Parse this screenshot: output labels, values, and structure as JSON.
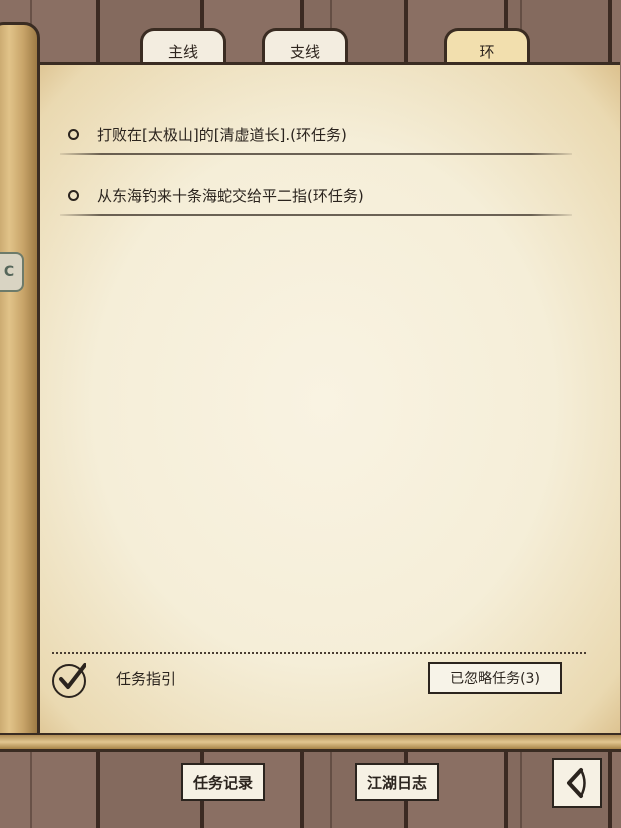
{
  "tabs": [
    {
      "label": "主线",
      "active": false
    },
    {
      "label": "支线",
      "active": false
    },
    {
      "label": "环",
      "active": true
    }
  ],
  "quests": [
    {
      "text": "打败在[太极山]的[清虚道长].(环任务)"
    },
    {
      "text": "从东海钓来十条海蛇交给平二指(环任务)"
    }
  ],
  "guide": {
    "label": "任务指引",
    "checked": true
  },
  "ignored_button": "已忽略任务(3)",
  "bottom": {
    "record_button": "任务记录",
    "journal_button": "江湖日志",
    "back_icon": "back-arrow-icon"
  },
  "side_badge": "C",
  "colors": {
    "paper": "#f5eed8",
    "active_tab": "#f2dfae",
    "ink": "#2b241e",
    "wood": "#8a6f63"
  }
}
